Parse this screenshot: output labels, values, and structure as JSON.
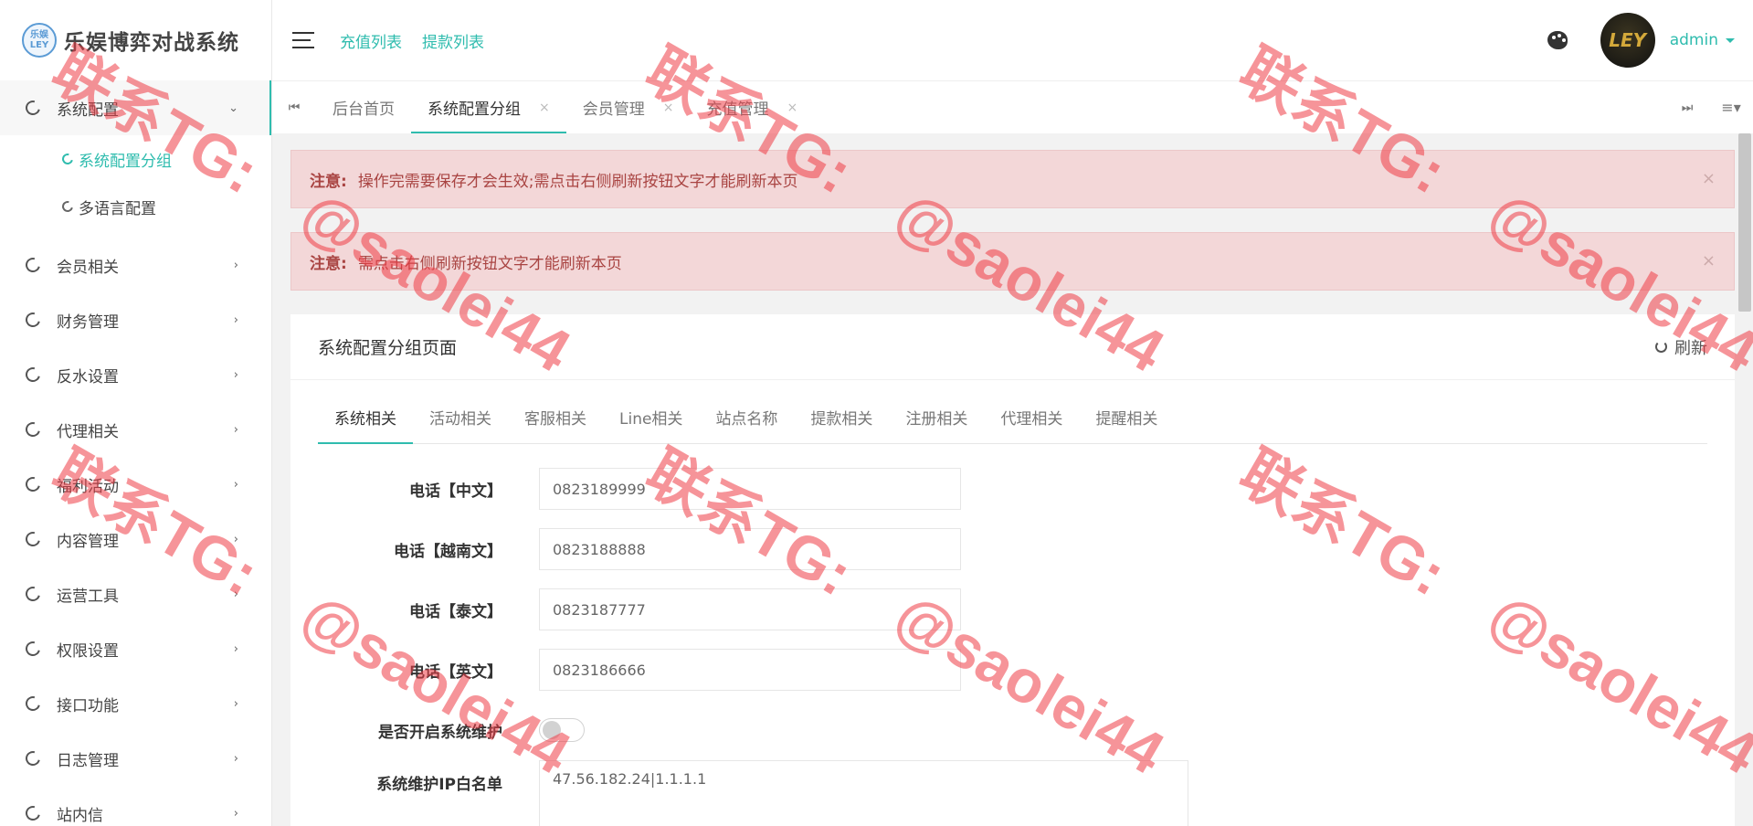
{
  "brand": {
    "logo_text": "乐娱\nLEY",
    "title": "乐娱博弈对战系统"
  },
  "sidebar": {
    "items": [
      {
        "label": "系统配置",
        "arrow": "⌄"
      },
      {
        "label": "会员相关",
        "arrow": "›"
      },
      {
        "label": "财务管理",
        "arrow": "›"
      },
      {
        "label": "反水设置",
        "arrow": "›"
      },
      {
        "label": "代理相关",
        "arrow": "›"
      },
      {
        "label": "福利活动",
        "arrow": "›"
      },
      {
        "label": "内容管理",
        "arrow": "›"
      },
      {
        "label": "运营工具",
        "arrow": "›"
      },
      {
        "label": "权限设置",
        "arrow": "›"
      },
      {
        "label": "接口功能",
        "arrow": "›"
      },
      {
        "label": "日志管理",
        "arrow": "›"
      },
      {
        "label": "站内信",
        "arrow": "›"
      }
    ],
    "submenu": [
      {
        "label": "系统配置分组"
      },
      {
        "label": "多语言配置"
      }
    ]
  },
  "header": {
    "links": [
      "充值列表",
      "提款列表"
    ],
    "avatar_text": "LEY",
    "user": "admin"
  },
  "page_tabs": {
    "prev": "⏮",
    "next": "⏭",
    "menu": "≡▾",
    "tabs": [
      {
        "label": "后台首页"
      },
      {
        "label": "系统配置分组",
        "close": "×"
      },
      {
        "label": "会员管理",
        "close": "×"
      },
      {
        "label": "充值管理",
        "close": "×"
      }
    ]
  },
  "alerts": [
    {
      "title": "注意:",
      "text": "操作完需要保存才会生效;需点击右侧刷新按钮文字才能刷新本页",
      "close": "×"
    },
    {
      "title": "注意:",
      "text": "需点击右侧刷新按钮文字才能刷新本页",
      "close": "×"
    }
  ],
  "panel": {
    "title": "系统配置分组页面",
    "refresh": "刷新",
    "sub_tabs": [
      "系统相关",
      "活动相关",
      "客服相关",
      "Line相关",
      "站点名称",
      "提款相关",
      "注册相关",
      "代理相关",
      "提醒相关"
    ],
    "fields": [
      {
        "label": "电话【中文】",
        "value": "0823189999"
      },
      {
        "label": "电话【越南文】",
        "value": "0823188888"
      },
      {
        "label": "电话【泰文】",
        "value": "0823187777"
      },
      {
        "label": "电话【英文】",
        "value": "0823186666"
      }
    ],
    "maintenance_label": "是否开启系统维护",
    "maintenance_on": false,
    "whitelist_label": "系统维护IP白名单",
    "whitelist_value": "47.56.182.24|1.1.1.1"
  },
  "watermark": {
    "line1": "联系TG:",
    "line2": "@saolei44"
  }
}
